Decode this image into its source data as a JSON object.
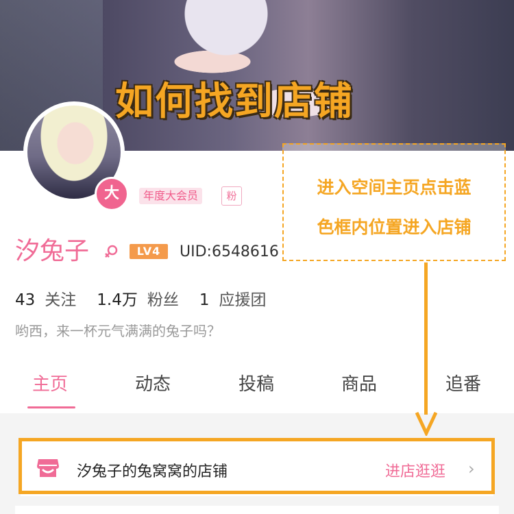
{
  "banner": {
    "title": "如何找到店铺"
  },
  "profile": {
    "level_badge": "大",
    "vip_tag": "年度大会员",
    "fan_tag": "粉",
    "username": "汐兔子",
    "lv": "LV4",
    "uid": "UID:6548616",
    "stats": [
      {
        "num": "43",
        "label": "关注"
      },
      {
        "num": "1.4万",
        "label": "粉丝"
      },
      {
        "num": "1",
        "label": "应援团"
      }
    ],
    "bio": "哟西，来一杯元气满满的兔子吗？"
  },
  "tabs": [
    "主页",
    "动态",
    "投稿",
    "商品",
    "追番"
  ],
  "store": {
    "name": "汐兔子的兔窝窝的店铺",
    "link": "进店逛逛",
    "chevron": "›"
  },
  "annotation": {
    "line1": "进入空间主页点击蓝",
    "line2": "色框内位置进入店铺"
  },
  "colors": {
    "accent": "#f06b96",
    "annotation": "#f5a623"
  }
}
